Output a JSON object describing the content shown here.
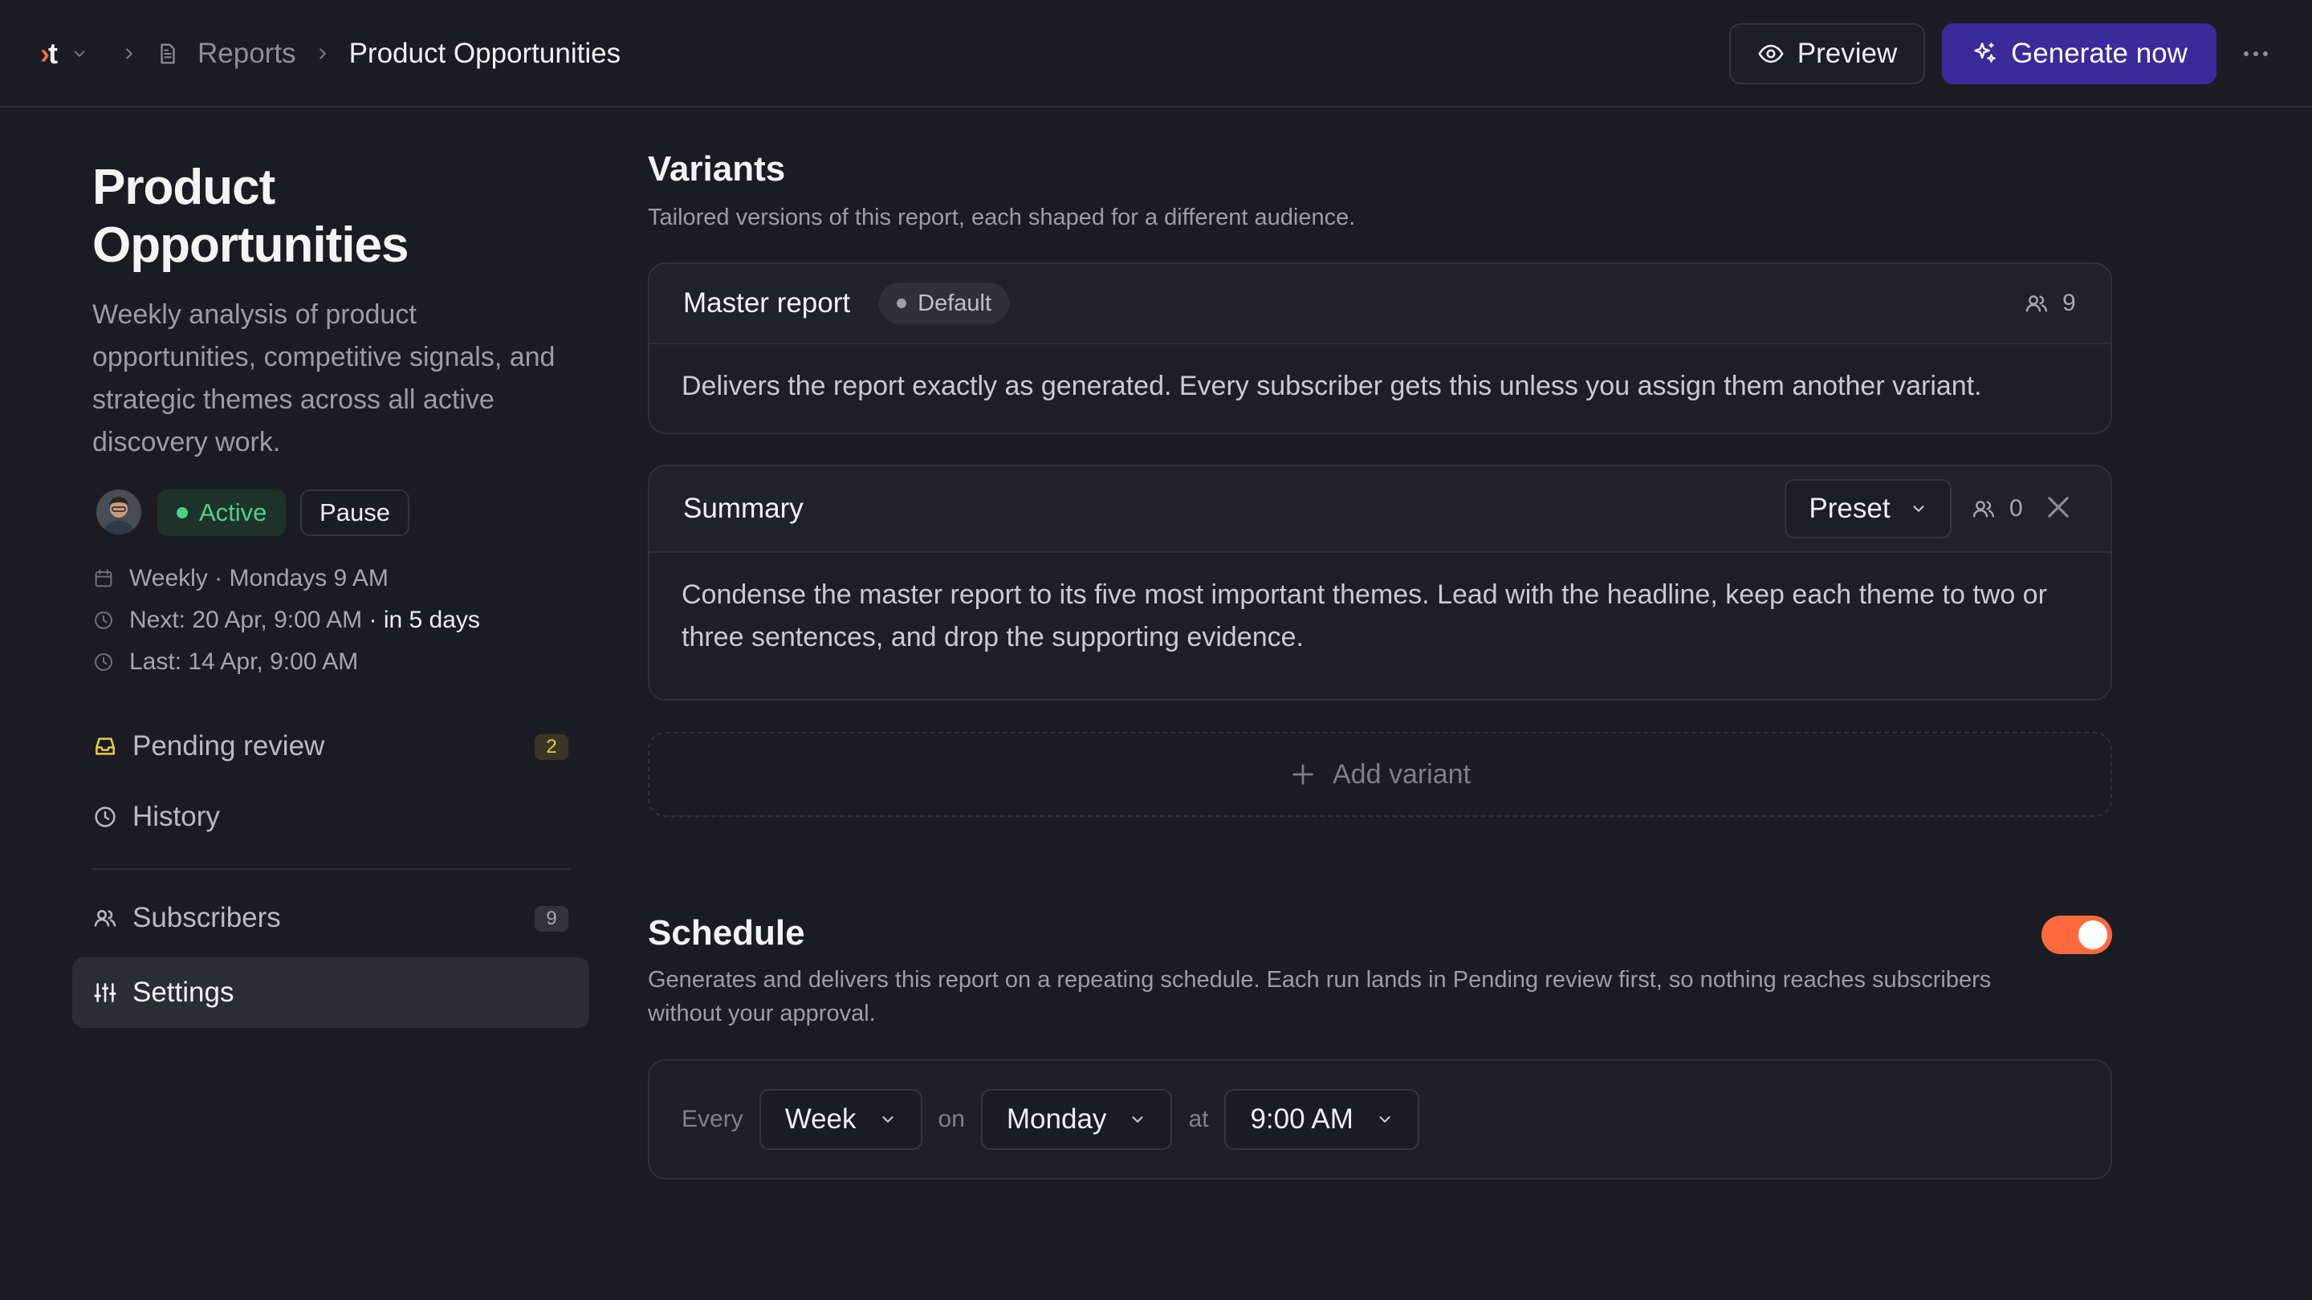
{
  "header": {
    "logo_text": "t",
    "breadcrumb": {
      "parent": "Reports",
      "current": "Product Opportunities"
    },
    "preview_label": "Preview",
    "generate_label": "Generate now"
  },
  "sidebar": {
    "title": "Product Opportunities",
    "description": "Weekly analysis of product opportunities, competitive signals, and strategic themes across all active discovery work.",
    "status": "Active",
    "pause_label": "Pause",
    "schedule_text": "Weekly · Mondays 9 AM",
    "next_text": "Next: 20 Apr, 9:00 AM",
    "next_relative": "· in 5 days",
    "last_text": "Last: 14 Apr, 9:00 AM",
    "nav": [
      {
        "label": "Pending review",
        "count": "2"
      },
      {
        "label": "History"
      },
      {
        "label": "Subscribers",
        "count": "9"
      },
      {
        "label": "Settings"
      }
    ]
  },
  "variants": {
    "heading": "Variants",
    "subtitle": "Tailored versions of this report, each shaped for a different audience.",
    "master": {
      "title": "Master report",
      "badge": "Default",
      "subscribers": "9",
      "body": "Delivers the report exactly as generated. Every subscriber gets this unless you assign them another variant."
    },
    "summary": {
      "title": "Summary",
      "mode": "Preset",
      "subscribers": "0",
      "body": "Condense the master report to its five most important themes. Lead with the headline, keep each theme to two or three sentences, and drop the supporting evidence."
    },
    "add_label": "Add variant"
  },
  "schedule": {
    "heading": "Schedule",
    "subtitle": "Generates and delivers this report on a repeating schedule. Each run lands in Pending review first, so nothing reaches subscribers without your approval.",
    "enabled": true,
    "every_label": "Every",
    "frequency": "Week",
    "on_label": "on",
    "day": "Monday",
    "at_label": "at",
    "time": "9:00 AM"
  },
  "colors": {
    "accent": "#ff6a3d",
    "primary_button": "#3b2a9a",
    "active_green": "#4cd08a",
    "pending_badge": "#e9c94a"
  }
}
